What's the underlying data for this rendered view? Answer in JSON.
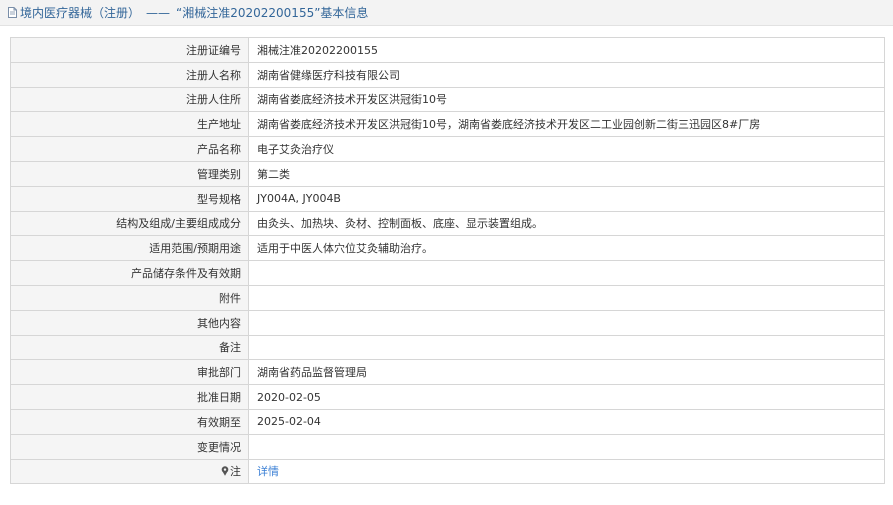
{
  "header": {
    "title": "境内医疗器械（注册）",
    "separator": "——",
    "subtitle": "“湘械注准20202200155”基本信息"
  },
  "rows": [
    {
      "label": "注册证编号",
      "value": "湘械注准20202200155"
    },
    {
      "label": "注册人名称",
      "value": "湖南省健缘医疗科技有限公司"
    },
    {
      "label": "注册人住所",
      "value": "湖南省娄底经济技术开发区洪冠街10号"
    },
    {
      "label": "生产地址",
      "value": "湖南省娄底经济技术开发区洪冠街10号，湖南省娄底经济技术开发区二工业园创新二街三迅园区8#厂房"
    },
    {
      "label": "产品名称",
      "value": "电子艾灸治疗仪"
    },
    {
      "label": "管理类别",
      "value": "第二类"
    },
    {
      "label": "型号规格",
      "value": "JY004A, JY004B"
    },
    {
      "label": "结构及组成/主要组成成分",
      "value": "由灸头、加热块、灸材、控制面板、底座、显示装置组成。"
    },
    {
      "label": "适用范围/预期用途",
      "value": "适用于中医人体穴位艾灸辅助治疗。"
    },
    {
      "label": "产品储存条件及有效期",
      "value": ""
    },
    {
      "label": "附件",
      "value": ""
    },
    {
      "label": "其他内容",
      "value": ""
    },
    {
      "label": "备注",
      "value": ""
    },
    {
      "label": "审批部门",
      "value": "湖南省药品监督管理局"
    },
    {
      "label": "批准日期",
      "value": "2020-02-05"
    },
    {
      "label": "有效期至",
      "value": "2025-02-04"
    },
    {
      "label": "变更情况",
      "value": ""
    }
  ],
  "note": {
    "label": "注",
    "icon": "pin-icon",
    "link_text": "详情"
  }
}
